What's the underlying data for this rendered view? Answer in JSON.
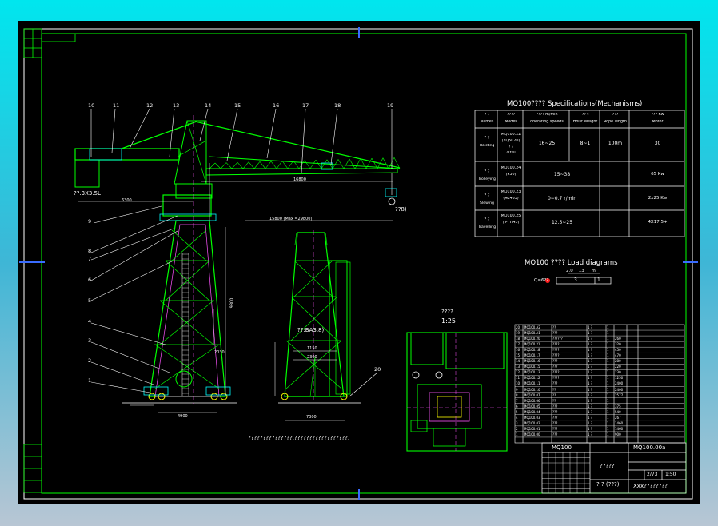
{
  "drawing": {
    "spec_title": "MQ100????   Specifications(Mechanisms)",
    "spec_headers": [
      {
        "top": "? ?",
        "bottom": "Names"
      },
      {
        "top": "????",
        "bottom": "Modes"
      },
      {
        "top": "???? m/min",
        "bottom": "operating speeds"
      },
      {
        "top": "?? t",
        "bottom": "Hoist Weight"
      },
      {
        "top": "???",
        "bottom": "Rope length"
      },
      {
        "top": "??? Kw",
        "bottom": "Motor"
      }
    ],
    "spec_rows": [
      {
        "name_top": "? ?",
        "name": "Hoisting",
        "mode": "MQ100.22",
        "mode2": "(YQ5020)",
        "c3": "? ?",
        "c3b": "4 fall",
        "speed": "16~25",
        "weight": "8~1",
        "rope": "100m",
        "motor": "30"
      },
      {
        "name_top": "? ?",
        "name": "Trolleying",
        "mode": "MQ100.24",
        "mode2": "(P30)",
        "speed": "15~38",
        "motor": "65 Kw"
      },
      {
        "name_top": "? ?",
        "name": "Slewing",
        "mode": "MQ100.23",
        "mode2": "(RC453)",
        "speed": "0~0.7 r/min",
        "motor": "2x25 Kw"
      },
      {
        "name_top": "? ?",
        "name": "Travelling",
        "mode": "MQ100.25",
        "mode2": "( PTH45)",
        "speed": "12.5~25",
        "motor": "4X17.5+"
      }
    ],
    "load_title": "MQ100 ????   Load diagrams",
    "load_scale": "2.0    13     m",
    "load_q": "Q=6??",
    "load_cells": [
      "3",
      "1"
    ],
    "callouts": [
      "10",
      "11",
      "12",
      "13",
      "14",
      "15",
      "16",
      "17",
      "18",
      "19",
      "9",
      "8",
      "7",
      "6",
      "5",
      "4",
      "3",
      "2",
      "1",
      "20"
    ],
    "dims": {
      "span": "16800",
      "reach": "15800 (Max =29800)",
      "jib_h": "1",
      "base_w": "4900",
      "portal_w": "7300",
      "tower_h": "9300",
      "hook_sym": "??8)",
      "counterweight": "??.3X3.5L",
      "portal_label": "??:BA3.8)",
      "portal_dim": "1150",
      "portal_dim2": "2300",
      "dim_a": "6300",
      "dim_b": "2030",
      "dim_c": "32000",
      "dim_d": "18000",
      "dim_e": "7500"
    },
    "detail_title": "????",
    "detail_scale": "1:25",
    "note": "???????????????,??????????????????.",
    "title_block": {
      "code": "MQ100",
      "drawing_no": "MQ100.00a",
      "name": "?????",
      "weight_label": "? ? (???)",
      "company": "Xxx????????",
      "scale": "1:50",
      "sheet": "2/73"
    },
    "parts_rows": [
      [
        "20",
        "MQ100.A2",
        "??",
        "1 ?",
        "1",
        "",
        ""
      ],
      [
        "19",
        "MQ100.A1",
        "???",
        "1 ?",
        "1",
        "",
        ""
      ],
      [
        "18",
        "MQ100.20",
        "??????",
        "1 ?",
        "1",
        "260",
        ""
      ],
      [
        "17",
        "MQ100.21",
        "????",
        "1 ?",
        "1",
        "320",
        ""
      ],
      [
        "16",
        "MQ100.18",
        "????",
        "1 ?",
        "1",
        "450",
        ""
      ],
      [
        "15",
        "MQ100.17",
        "????",
        "1 ?",
        "1",
        "470",
        ""
      ],
      [
        "14",
        "MQ100.16",
        "???",
        "1 ?",
        "1",
        "280",
        ""
      ],
      [
        "13",
        "MQ100.15",
        "???",
        "1 ?",
        "1",
        "220",
        ""
      ],
      [
        "12",
        "MQ100.13",
        "????",
        "1 ?",
        "1",
        "230",
        ""
      ],
      [
        "11",
        "MQ100.12",
        "????",
        "1 ?",
        "1",
        "1250",
        ""
      ],
      [
        "10",
        "MQ100.11",
        "???",
        "1 ?",
        "1",
        "2400",
        ""
      ],
      [
        "9",
        "MQ100.10",
        "??",
        "1 ?",
        "1",
        "2400",
        ""
      ],
      [
        "8",
        "MQ100.07",
        "??",
        "1 ?",
        "1",
        "2577",
        ""
      ],
      [
        "7",
        "MQ100.06",
        "??",
        "1 ?",
        "1",
        "",
        ""
      ],
      [
        "6",
        "MQ100.05",
        "???",
        "1 ?",
        "1",
        "375",
        ""
      ],
      [
        "5",
        "MQ100.04",
        "???",
        "1 ?",
        "1",
        "540",
        ""
      ],
      [
        "4",
        "MQ100.03",
        "???",
        "1 ?",
        "1",
        "267",
        ""
      ],
      [
        "3",
        "MQ100.02",
        "???",
        "1 ?",
        "1",
        "1460",
        ""
      ],
      [
        "2",
        "MQ100.01",
        "???",
        "1 ?",
        "1",
        "1460",
        ""
      ],
      [
        "1",
        "MQ100.00",
        "???",
        "1 ?",
        "1",
        "900",
        ""
      ]
    ]
  }
}
